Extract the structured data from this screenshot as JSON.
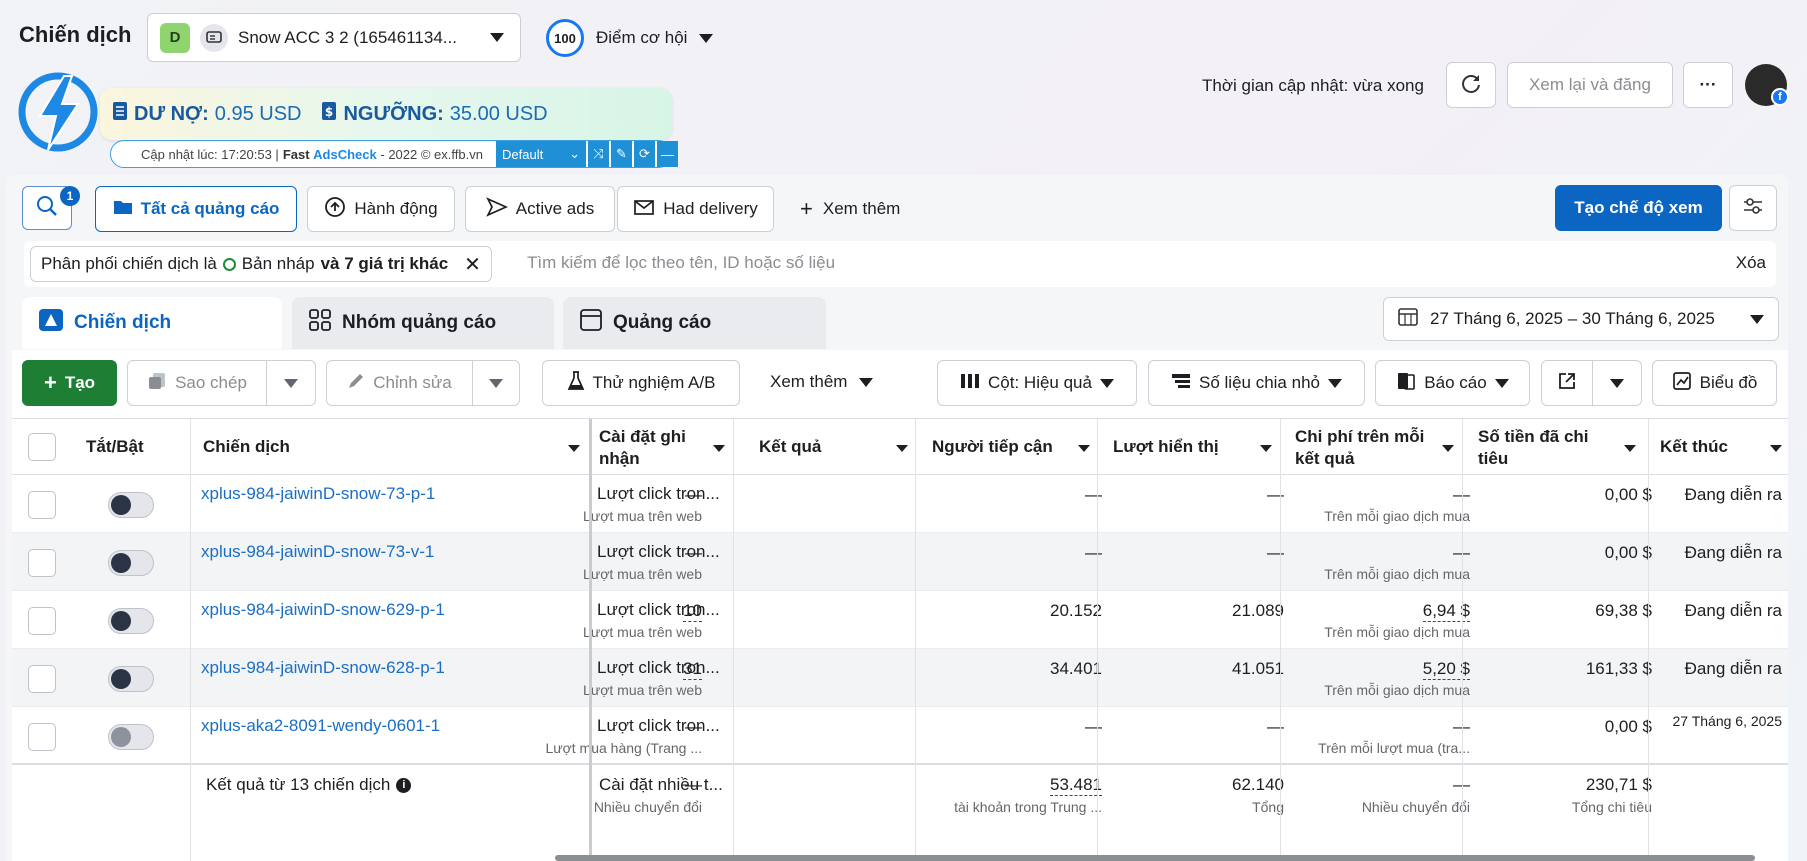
{
  "header": {
    "title": "Chiến dịch",
    "account_badge": "D",
    "account_name": "Snow ACC 3 2 (165461134...",
    "score": "100",
    "score_label": "Điểm cơ hội",
    "update_text": "Thời gian cập nhật: vừa xong",
    "review_button": "Xem lại và đăng",
    "more_button": "···"
  },
  "plugin": {
    "debt_label": "DƯ NỢ:",
    "debt_value": "0.95 USD",
    "threshold_label": "NGƯỠNG:",
    "threshold_value": "35.00 USD",
    "updated": "Cập nhật lúc: 17:20:53 |",
    "brand_fast": "Fast",
    "brand_ads": "AdsCheck",
    "copyright": "- 2022 © ex.ffb.vn",
    "preset": "Default"
  },
  "filters": {
    "search_badge": "1",
    "all_ads": "Tất cả quảng cáo",
    "actions": "Hành động",
    "active_ads": "Active ads",
    "had_delivery": "Had delivery",
    "see_more": "Xem thêm",
    "create_view": "Tạo chế độ xem",
    "chip_prefix": "Phân phối chiến dịch là",
    "chip_value": "Bản nháp",
    "chip_more": "và 7 giá trị khác",
    "search_placeholder": "Tìm kiếm để lọc theo tên, ID hoặc số liệu",
    "clear": "Xóa"
  },
  "tabs": {
    "campaigns": "Chiến dịch",
    "ad_sets": "Nhóm quảng cáo",
    "ads": "Quảng cáo"
  },
  "date_range": "27 Tháng 6, 2025 – 30 Tháng 6, 2025",
  "toolbar": {
    "create": "Tạo",
    "duplicate": "Sao chép",
    "edit": "Chỉnh sửa",
    "ab_test": "Thử nghiệm A/B",
    "see_more": "Xem thêm",
    "columns": "Cột: Hiệu quả",
    "breakdown": "Số liệu chia nhỏ",
    "reports": "Báo cáo",
    "charts": "Biểu đồ"
  },
  "columns": {
    "toggle": "Tắt/Bật",
    "campaign": "Chiến dịch",
    "attribution": "Cài đặt ghi nhận",
    "results": "Kết quả",
    "reach": "Người tiếp cận",
    "impressions": "Lượt hiển thị",
    "cost_per_result": "Chi phí trên mỗi kết quả",
    "amount_spent": "Số tiền đã chi tiêu",
    "ends": "Kết thúc"
  },
  "rows": [
    {
      "name": "xplus-984-jaiwinD-snow-73-p-1",
      "attribution": "Lượt click tron...",
      "results": "—",
      "results_sub": "Lượt mua trên web",
      "reach": "—",
      "impressions": "—",
      "cpr": "—",
      "cpr_sub": "Trên mỗi giao dịch mua",
      "spent": "0,00 $",
      "ends": "Đang diễn ra"
    },
    {
      "name": "xplus-984-jaiwinD-snow-73-v-1",
      "attribution": "Lượt click tron...",
      "results": "—",
      "results_sub": "Lượt mua trên web",
      "reach": "—",
      "impressions": "—",
      "cpr": "—",
      "cpr_sub": "Trên mỗi giao dịch mua",
      "spent": "0,00 $",
      "ends": "Đang diễn ra"
    },
    {
      "name": "xplus-984-jaiwinD-snow-629-p-1",
      "attribution": "Lượt click tron...",
      "results": "10",
      "results_sub": "Lượt mua trên web",
      "reach": "20.152",
      "impressions": "21.089",
      "cpr": "6,94 $",
      "cpr_sub": "Trên mỗi giao dịch mua",
      "spent": "69,38 $",
      "ends": "Đang diễn ra"
    },
    {
      "name": "xplus-984-jaiwinD-snow-628-p-1",
      "attribution": "Lượt click tron...",
      "results": "31",
      "results_sub": "Lượt mua trên web",
      "reach": "34.401",
      "impressions": "41.051",
      "cpr": "5,20 $",
      "cpr_sub": "Trên mỗi giao dịch mua",
      "spent": "161,33 $",
      "ends": "Đang diễn ra"
    },
    {
      "name": "xplus-aka2-8091-wendy-0601-1",
      "attribution": "Lượt click tron...",
      "results": "—",
      "results_sub": "Lượt mua hàng (Trang ...",
      "reach": "—",
      "impressions": "—",
      "cpr": "—",
      "cpr_sub": "Trên mỗi lượt mua (tra...",
      "spent": "0,00 $",
      "ends": "27 Tháng 6, 2025"
    }
  ],
  "totals": {
    "label": "Kết quả từ 13 chiến dịch",
    "attribution": "Cài đặt nhiều t...",
    "results": "—",
    "results_sub": "Nhiều chuyển đổi",
    "reach": "53.481",
    "reach_sub": "tài khoản trong Trung ...",
    "impressions": "62.140",
    "impressions_sub": "Tổng",
    "cpr": "—",
    "cpr_sub": "Nhiều chuyển đổi",
    "spent": "230,71 $",
    "spent_sub": "Tổng chi tiêu"
  },
  "colors": {
    "primary_blue": "#0a66c2",
    "create_green": "#1e7e34",
    "link_blue": "#1a6ec4"
  }
}
